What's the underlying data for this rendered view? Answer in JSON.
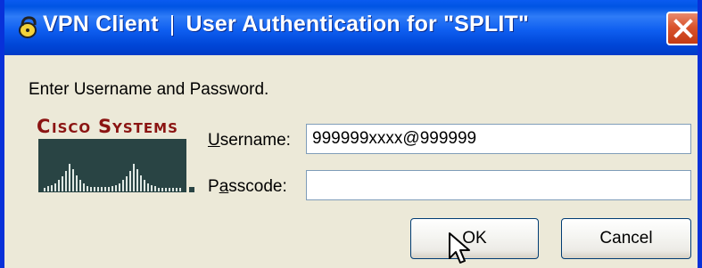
{
  "window": {
    "app_name": "VPN Client",
    "separator": "|",
    "dialog_title": "User Authentication for \"SPLIT\"",
    "accent_color": "#0054e3",
    "close_icon": "close-icon"
  },
  "dialog": {
    "prompt": "Enter Username and Password.",
    "logo_text": "Cisco Systems",
    "logo_color": "#8b1412"
  },
  "fields": {
    "username_label": "Username:",
    "username_value": "999999xxxx@999999",
    "passcode_label": "Passcode:",
    "passcode_value": ""
  },
  "buttons": {
    "ok_label": "OK",
    "cancel_label": "Cancel"
  }
}
